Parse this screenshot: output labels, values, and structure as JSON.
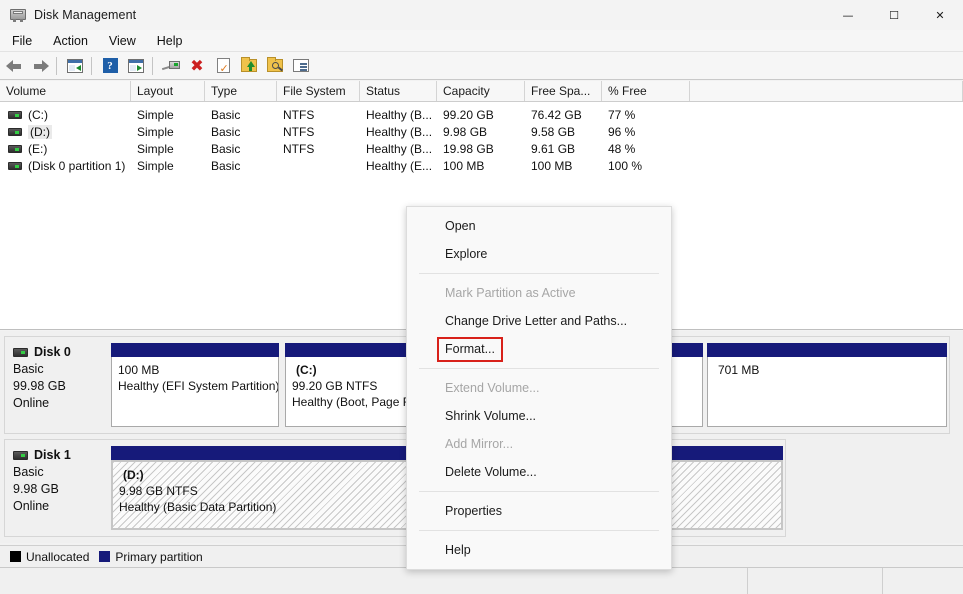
{
  "window": {
    "title": "Disk Management",
    "icon": "disk-drive-icon",
    "controls": {
      "minimize": "—",
      "maximize": "☐",
      "close": "✕"
    }
  },
  "menubar": {
    "items": [
      "File",
      "Action",
      "View",
      "Help"
    ]
  },
  "toolbar": {
    "buttons": [
      "back-arrow-icon",
      "forward-arrow-icon",
      "separator",
      "up-one-level-icon",
      "separator",
      "help-icon",
      "properties-window-icon",
      "separator",
      "rescan-disks-icon",
      "delete-icon",
      "check-page-icon",
      "folder-up-icon",
      "folder-search-icon",
      "list-view-icon"
    ]
  },
  "volume_list": {
    "columns": [
      "Volume",
      "Layout",
      "Type",
      "File System",
      "Status",
      "Capacity",
      "Free Spa...",
      "% Free"
    ],
    "rows": [
      {
        "volume": "(C:)",
        "layout": "Simple",
        "type": "Basic",
        "filesystem": "NTFS",
        "status": "Healthy (B...",
        "capacity": "99.20 GB",
        "free_space": "76.42 GB",
        "percent_free": "77 %",
        "selected": false
      },
      {
        "volume": "(D:)",
        "layout": "Simple",
        "type": "Basic",
        "filesystem": "NTFS",
        "status": "Healthy (B...",
        "capacity": "9.98 GB",
        "free_space": "9.58 GB",
        "percent_free": "96 %",
        "selected": true
      },
      {
        "volume": "(E:)",
        "layout": "Simple",
        "type": "Basic",
        "filesystem": "NTFS",
        "status": "Healthy (B...",
        "capacity": "19.98 GB",
        "free_space": "9.61 GB",
        "percent_free": "48 %",
        "selected": false
      },
      {
        "volume": "(Disk 0 partition 1)",
        "layout": "Simple",
        "type": "Basic",
        "filesystem": "",
        "status": "Healthy (E...",
        "capacity": "100 MB",
        "free_space": "100 MB",
        "percent_free": "100 %",
        "selected": false
      }
    ]
  },
  "disks": [
    {
      "name": "Disk 0",
      "type": "Basic",
      "size": "99.98 GB",
      "state": "Online",
      "partitions": [
        {
          "label": "",
          "size_fs": "100 MB",
          "status": "Healthy (EFI System Partition)",
          "selected": false
        },
        {
          "label": "(C:)",
          "size_fs": "99.20 GB NTFS",
          "status": "Healthy (Boot, Page Fil",
          "selected": false
        },
        {
          "label": "",
          "size_fs": "701 MB",
          "status": "",
          "selected": false
        }
      ]
    },
    {
      "name": "Disk 1",
      "type": "Basic",
      "size": "9.98 GB",
      "state": "Online",
      "partitions": [
        {
          "label": "(D:)",
          "size_fs": "9.98 GB NTFS",
          "status": "Healthy (Basic Data Partition)",
          "selected": true
        }
      ]
    }
  ],
  "legend": [
    {
      "label": "Unallocated",
      "color": "#000000"
    },
    {
      "label": "Primary partition",
      "color": "#161a7a"
    }
  ],
  "context_menu": {
    "items": [
      {
        "label": "Open",
        "disabled": false,
        "highlighted": false
      },
      {
        "label": "Explore",
        "disabled": false,
        "highlighted": false
      },
      {
        "separator": true
      },
      {
        "label": "Mark Partition as Active",
        "disabled": true,
        "highlighted": false
      },
      {
        "label": "Change Drive Letter and Paths...",
        "disabled": false,
        "highlighted": false
      },
      {
        "label": "Format...",
        "disabled": false,
        "highlighted": true
      },
      {
        "separator": true
      },
      {
        "label": "Extend Volume...",
        "disabled": true,
        "highlighted": false
      },
      {
        "label": "Shrink Volume...",
        "disabled": false,
        "highlighted": false
      },
      {
        "label": "Add Mirror...",
        "disabled": true,
        "highlighted": false
      },
      {
        "label": "Delete Volume...",
        "disabled": false,
        "highlighted": false
      },
      {
        "separator": true
      },
      {
        "label": "Properties",
        "disabled": false,
        "highlighted": false
      },
      {
        "separator": true
      },
      {
        "label": "Help",
        "disabled": false,
        "highlighted": false
      }
    ],
    "highlight_color": "#d8211a"
  },
  "statusbar": {
    "sections": [
      "",
      "",
      ""
    ]
  }
}
